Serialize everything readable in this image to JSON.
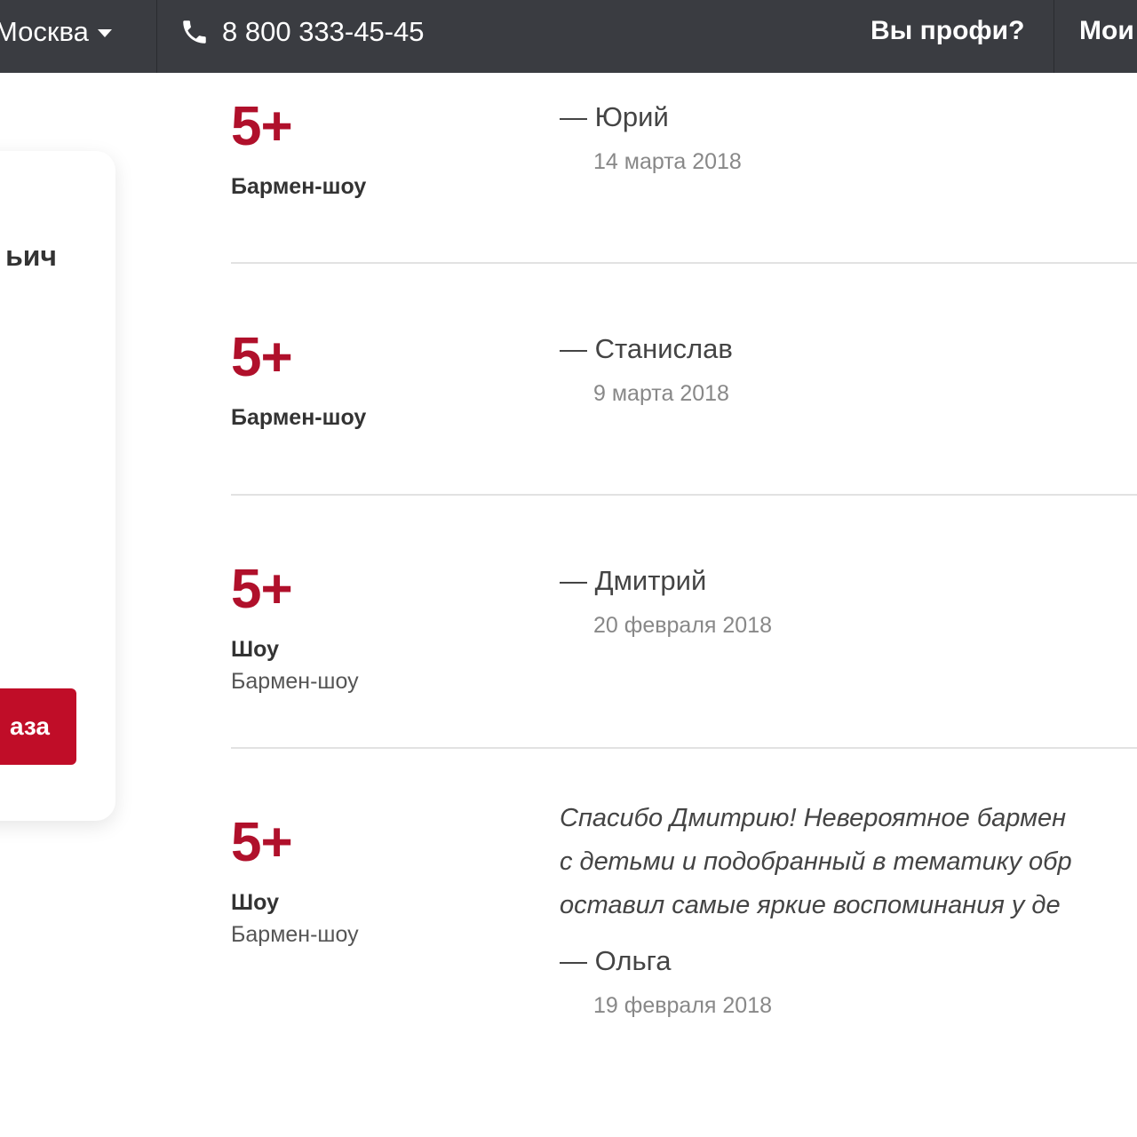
{
  "header": {
    "city": "Москва",
    "phone": "8 800 333-45-45",
    "pro_link": "Вы профи?",
    "my_link": "Мои"
  },
  "card": {
    "name_fragment": "ьич",
    "order_button": "аза"
  },
  "reviews": [
    {
      "score": "5+",
      "category_bold": "Бармен-шоу",
      "category_light": "",
      "text_lines": [],
      "author": "— Юрий",
      "date": "14 марта 2018"
    },
    {
      "score": "5+",
      "category_bold": "Бармен-шоу",
      "category_light": "",
      "text_lines": [],
      "author": "— Станислав",
      "date": "9 марта 2018"
    },
    {
      "score": "5+",
      "category_bold": "Шоу",
      "category_light": "Бармен-шоу",
      "text_lines": [],
      "author": "— Дмитрий",
      "date": "20 февраля 2018"
    },
    {
      "score": "5+",
      "category_bold": "Шоу",
      "category_light": "Бармен-шоу",
      "text_lines": [
        "Спасибо Дмитрию! Невероятное бармен",
        "с детьми и подобранный в тематику обр",
        "оставил самые яркие воспоминания у де"
      ],
      "author": "— Ольга",
      "date": "19 февраля 2018"
    }
  ],
  "colors": {
    "topbar": "#3a3c41",
    "accent": "#b0102b",
    "button": "#c00d28"
  }
}
